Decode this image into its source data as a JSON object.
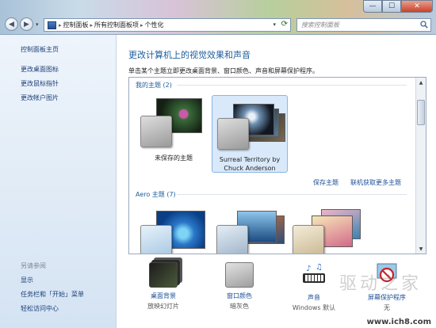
{
  "window": {
    "minimize": "—",
    "maximize": "☐",
    "close": "✕"
  },
  "nav": {
    "back": "◀",
    "forward": "▶",
    "dropdown": "▾"
  },
  "address": {
    "crumbs": [
      "控制面板",
      "所有控制面板项",
      "个性化"
    ],
    "separator": "▸",
    "dropdown": "▾",
    "refresh": "⟳"
  },
  "search": {
    "placeholder": "搜索控制面板"
  },
  "sidebar": {
    "home": "控制面板主页",
    "links": [
      "更改桌面图标",
      "更改鼠标指针",
      "更改帐户图片"
    ],
    "see_also_heading": "另请参阅",
    "see_also": [
      "显示",
      "任务栏和「开始」菜单",
      "轻松访问中心"
    ]
  },
  "main": {
    "title": "更改计算机上的视觉效果和声音",
    "description": "单击某个主题立即更改桌面背景、窗口颜色、声音和屏幕保护程序。"
  },
  "themes": {
    "my_themes_heading": "我的主题 (2)",
    "unsaved_caption": "未保存的主题",
    "surreal_caption_line1": "Surreal Territory by",
    "surreal_caption_line2": "Chuck Anderson",
    "save_theme": "保存主题",
    "get_more_online": "联机获取更多主题",
    "aero_heading": "Aero 主题 (7)"
  },
  "bottom": {
    "desktop_bg_label": "桌面背景",
    "desktop_bg_sub": "放映幻灯片",
    "window_color_label": "窗口颜色",
    "window_color_sub": "暗灰色",
    "sound_label": "声音",
    "sound_sub": "Windows 默认",
    "screensaver_label": "屏幕保护程序",
    "screensaver_sub": "无"
  },
  "watermark": {
    "site": "www.ich8.com",
    "art": "驱动之家"
  },
  "icons": {
    "back": "back-arrow-icon",
    "forward": "forward-arrow-icon",
    "search": "search-icon",
    "refresh": "refresh-icon",
    "control_panel": "control-panel-icon"
  },
  "colors": {
    "link": "#1b4f96",
    "title": "#1d5d9d",
    "selected_tile": "#d9e9fa"
  }
}
